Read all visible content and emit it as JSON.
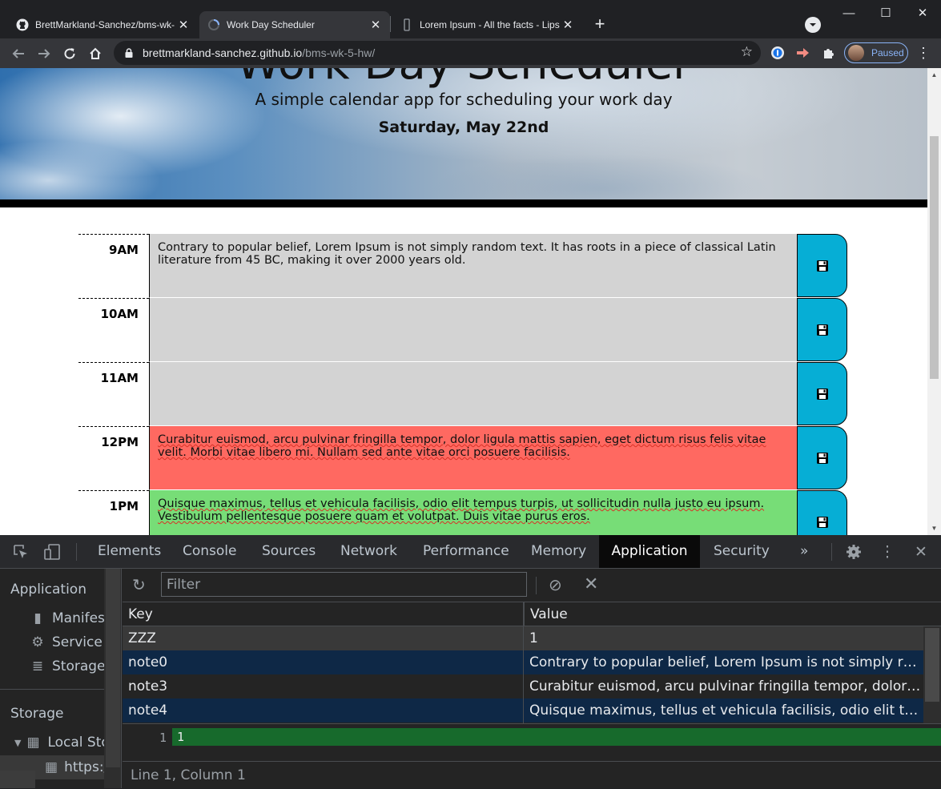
{
  "browser": {
    "tabs": [
      {
        "title": "BrettMarkland-Sanchez/bms-wk-",
        "icon": "github-icon"
      },
      {
        "title": "Work Day Scheduler",
        "icon": "loading-icon"
      },
      {
        "title": "Lorem Ipsum - All the facts - Lips",
        "icon": "lipsum-icon"
      }
    ],
    "url_host": "brettmarkland-sanchez.github.io",
    "url_path": "/bms-wk-5-hw/",
    "profile_label": "Paused"
  },
  "page": {
    "title": "Work Day Scheduler",
    "subtitle": "A simple calendar app for scheduling your work day",
    "date": "Saturday, May 22nd",
    "rows": [
      {
        "hour": "9AM",
        "text": "Contrary to popular belief, Lorem Ipsum is not simply random text. It has roots in a piece of classical Latin literature from 45 BC, making it over 2000 years old.",
        "state": "past"
      },
      {
        "hour": "10AM",
        "text": "",
        "state": "past"
      },
      {
        "hour": "11AM",
        "text": "",
        "state": "past"
      },
      {
        "hour": "12PM",
        "text": "Curabitur euismod, arcu pulvinar fringilla tempor, dolor ligula mattis sapien, eget dictum risus felis vitae velit. Morbi vitae libero mi. Nullam sed ante vitae orci posuere facilisis.",
        "state": "present"
      },
      {
        "hour": "1PM",
        "text": "Quisque maximus, tellus et vehicula facilisis, odio elit tempus turpis, ut sollicitudin nulla justo eu ipsum. Vestibulum pellentesque posuere quam et volutpat. Duis vitae purus eros.",
        "state": "future"
      }
    ],
    "colors": {
      "past": "#d3d3d3",
      "present": "#ff6961",
      "future": "#77dd77",
      "save": "#06aed5"
    }
  },
  "devtools": {
    "tabs": [
      "Elements",
      "Console",
      "Sources",
      "Network",
      "Performance",
      "Memory",
      "Application",
      "Security"
    ],
    "active_tab": "Application",
    "more_tabs": "»",
    "sidebar": {
      "section_app": "Application",
      "app_items": [
        {
          "label": "Manifest",
          "icon": "document-icon"
        },
        {
          "label": "Service Workers",
          "icon": "gear-icon"
        },
        {
          "label": "Storage",
          "icon": "database-icon"
        }
      ],
      "section_storage": "Storage",
      "local_storage": "Local Storage",
      "origin": "https://brettmarkland-sanchez.github.io"
    },
    "filter_placeholder": "Filter",
    "columns": {
      "key": "Key",
      "value": "Value"
    },
    "entries": [
      {
        "key": "ZZZ",
        "value": "1"
      },
      {
        "key": "note0",
        "value": "Contrary to popular belief, Lorem Ipsum is not simply rand..."
      },
      {
        "key": "note3",
        "value": "Curabitur euismod, arcu pulvinar fringilla tempor, dolor ligu..."
      },
      {
        "key": "note4",
        "value": "Quisque maximus, tellus et vehicula facilisis, odio elit tempu..."
      }
    ],
    "preview": {
      "line": "1",
      "code": "1"
    },
    "status": "Line 1, Column 1"
  }
}
